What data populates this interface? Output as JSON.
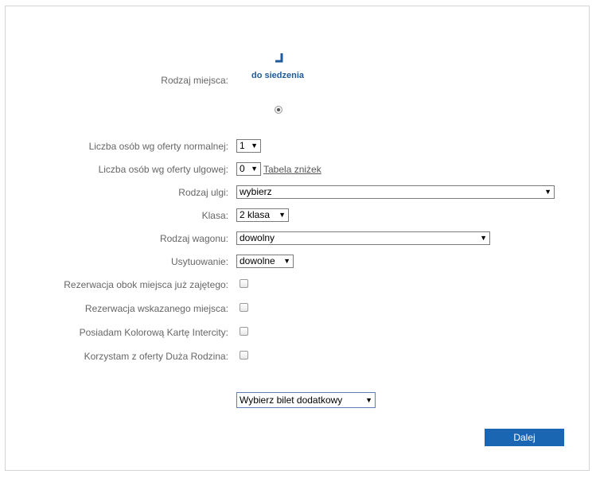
{
  "seat_type": {
    "label": "Rodzaj miejsca:",
    "option_label": "do siedzenia",
    "icon": "seat-icon"
  },
  "fields": {
    "normal_count": {
      "label": "Liczba osób wg oferty normalnej:",
      "value": "1"
    },
    "reduced_count": {
      "label": "Liczba osób wg oferty ulgowej:",
      "value": "0",
      "link": "Tabela zniżek"
    },
    "discount_type": {
      "label": "Rodzaj ulgi:",
      "value": "wybierz"
    },
    "class": {
      "label": "Klasa:",
      "value": "2 klasa"
    },
    "wagon_type": {
      "label": "Rodzaj wagonu:",
      "value": "dowolny"
    },
    "placement": {
      "label": "Usytuowanie:",
      "value": "dowolne"
    }
  },
  "checkboxes": [
    {
      "label": "Rezerwacja obok miejsca już zajętego:",
      "checked": false
    },
    {
      "label": "Rezerwacja wskazanego miejsca:",
      "checked": false
    },
    {
      "label": "Posiadam Kolorową Kartę Intercity:",
      "checked": false
    },
    {
      "label": "Korzystam z oferty Duża Rodzina:",
      "checked": false
    }
  ],
  "extra_ticket": {
    "value": "Wybierz bilet dodatkowy"
  },
  "next_button": {
    "label": "Dalej"
  },
  "colors": {
    "accent": "#1a66b3",
    "link_blue": "#1f5b9c"
  }
}
